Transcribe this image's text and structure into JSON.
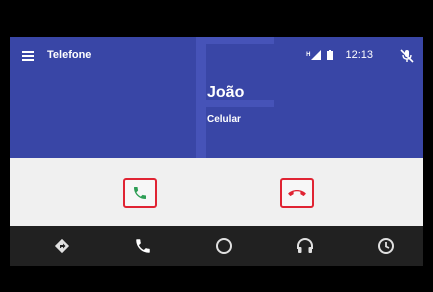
{
  "header": {
    "menu_icon": "menu-icon",
    "title": "Telefone",
    "status_icons": [
      "bluetooth-icon",
      "signal-icon",
      "battery-icon"
    ],
    "signal_prefix": "H",
    "time": "12:13",
    "mic_icon": "mic-off-icon"
  },
  "call": {
    "caller_name": "João",
    "caller_type": "Celular",
    "answer_icon": "phone-answer-icon",
    "decline_icon": "phone-decline-icon"
  },
  "navbar": {
    "items": [
      "navigation-icon",
      "phone-icon",
      "home-icon",
      "headphones-icon",
      "recent-icon"
    ]
  },
  "colors": {
    "incall_bg": "#3946a6",
    "actions_bg": "#f0f0f0",
    "navbar_bg": "#212121",
    "answer_green": "#2e9e55",
    "decline_red": "#e02433"
  }
}
